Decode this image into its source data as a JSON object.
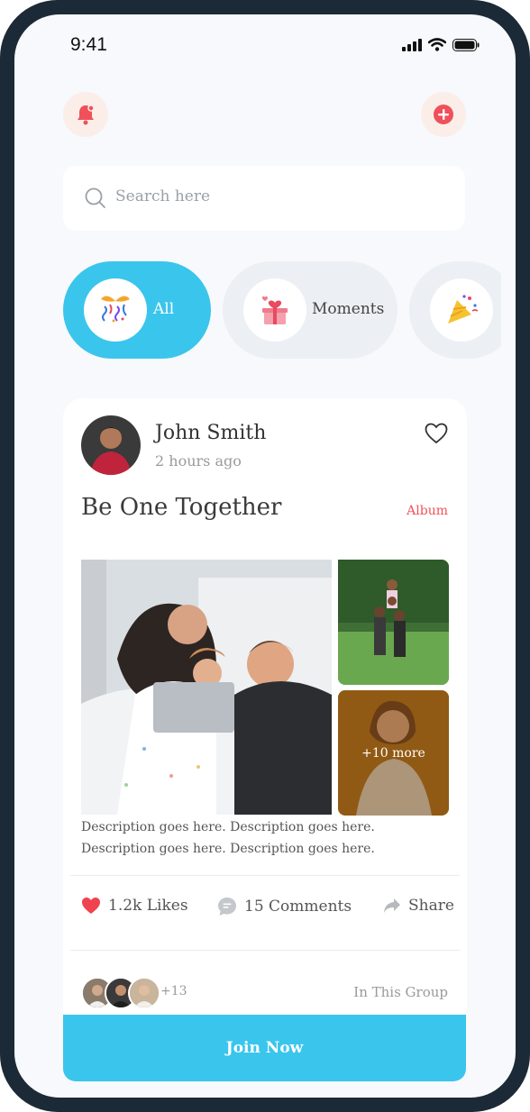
{
  "status": {
    "time": "9:41"
  },
  "header": {
    "notification_icon": "bell-icon",
    "add_icon": "plus-circle-icon",
    "accent": "#f0505a"
  },
  "search": {
    "placeholder": "Search here"
  },
  "categories": [
    {
      "label": "All",
      "icon": "party-gift-icon",
      "active": true
    },
    {
      "label": "Moments",
      "icon": "gift-hearts-icon",
      "active": false
    },
    {
      "label": "",
      "icon": "party-popper-icon",
      "active": false
    }
  ],
  "post": {
    "author": "John Smith",
    "time": "2 hours ago",
    "title": "Be One Together",
    "album_label": "Album",
    "more_photos": "+10 more",
    "description": "Description goes here. Description goes here. Description goes here. Description goes here.",
    "likes": "1.2k Likes",
    "comments": "15 Comments",
    "share": "Share",
    "member_count": "+13",
    "group_label": "In This Group"
  },
  "join_button": "Join Now",
  "colors": {
    "primary": "#3ac5ec",
    "accent": "#f0505a",
    "background": "#f7f9fc",
    "frame": "#1b2a36"
  }
}
